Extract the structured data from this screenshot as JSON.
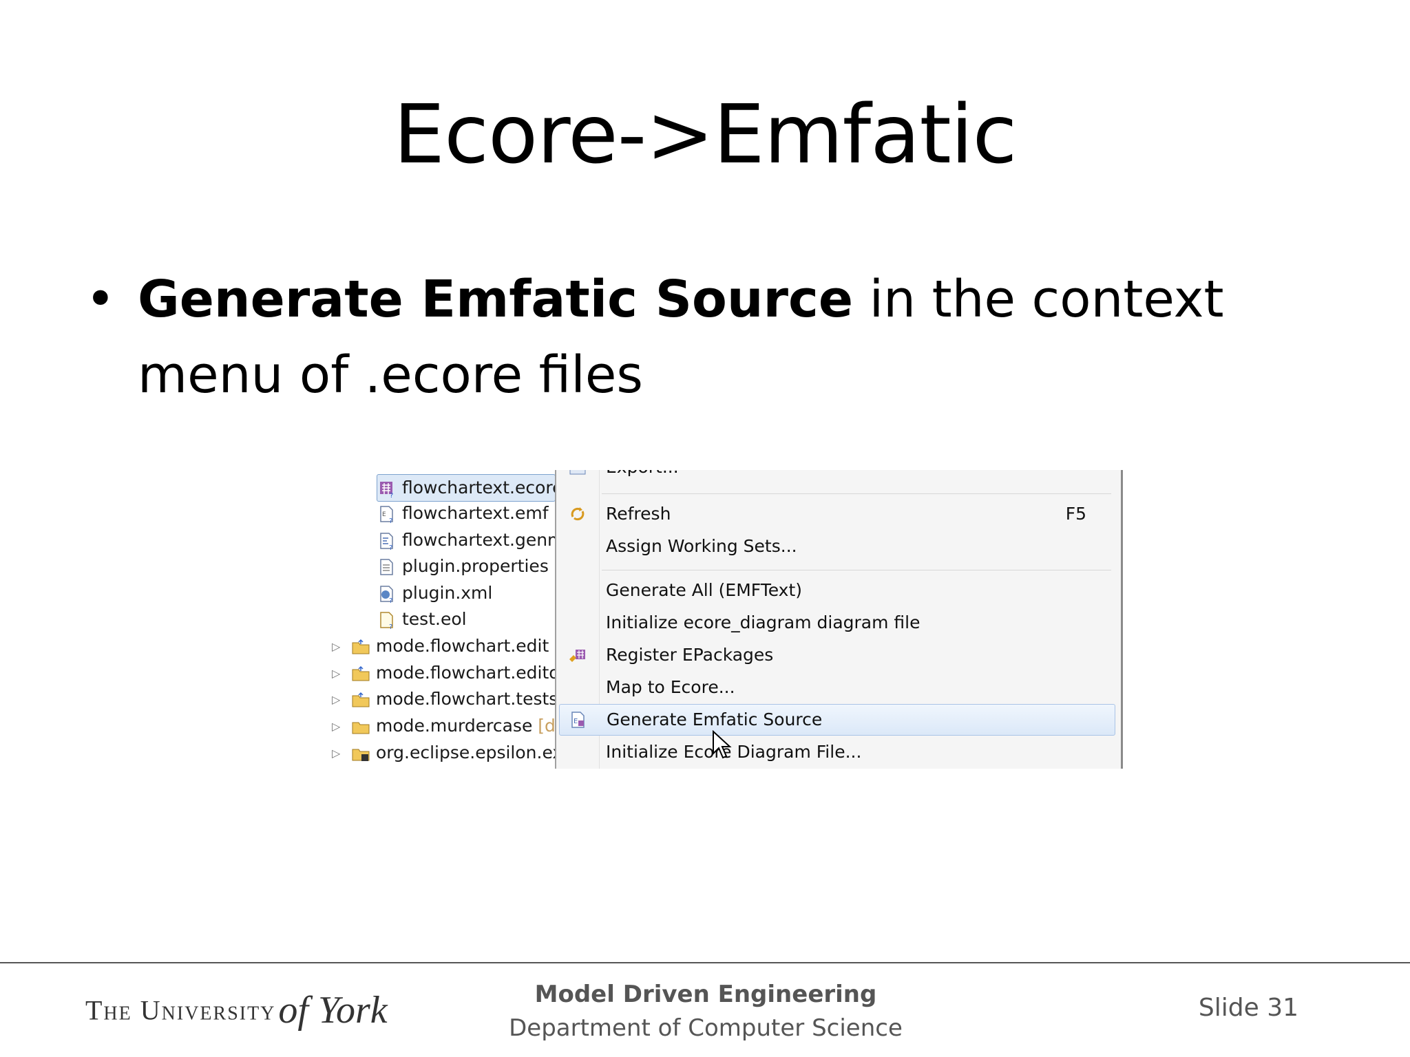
{
  "slide": {
    "title": "Ecore->Emfatic",
    "bullet_marker": "•",
    "bullet_bold": "Generate Emfatic Source",
    "bullet_rest": " in the context menu of .ecore files"
  },
  "tree": {
    "items": [
      {
        "label": "flowchartext.ecore",
        "icon": "ecore-file-icon",
        "selected": true
      },
      {
        "label": "flowchartext.emf",
        "icon": "emf-file-icon"
      },
      {
        "label": "flowchartext.genm",
        "icon": "genmodel-file-icon"
      },
      {
        "label": "plugin.properties",
        "icon": "properties-file-icon"
      },
      {
        "label": "plugin.xml",
        "icon": "plugin-xml-icon"
      },
      {
        "label": "test.eol",
        "icon": "eol-file-icon"
      },
      {
        "label": "mode.flowchart.edit",
        "icon": "project-folder-icon"
      },
      {
        "label": "mode.flowchart.editor",
        "icon": "project-folder-icon"
      },
      {
        "label": "mode.flowchart.tests",
        "icon": "project-folder-icon"
      },
      {
        "label": "mode.murdercase",
        "suffix": " [dir",
        "icon": "project-folder-icon"
      },
      {
        "label": "org.eclipse.epsilon.exa",
        "icon": "project-folder-icon"
      }
    ]
  },
  "menu": {
    "export": "Export...",
    "refresh": "Refresh",
    "refresh_shortcut": "F5",
    "assign": "Assign Working Sets...",
    "generate_all": "Generate All (EMFText)",
    "init_diagram": "Initialize ecore_diagram diagram file",
    "register": "Register EPackages",
    "map": "Map to Ecore...",
    "generate_emfatic": "Generate Emfatic Source",
    "init_ecore_diagram": "Initialize Ecore Diagram File..."
  },
  "footer": {
    "logo_caps": "The University",
    "logo_script": "of York",
    "course": "Model Driven Engineering",
    "department": "Department of Computer Science",
    "slide_number": "Slide 31"
  }
}
